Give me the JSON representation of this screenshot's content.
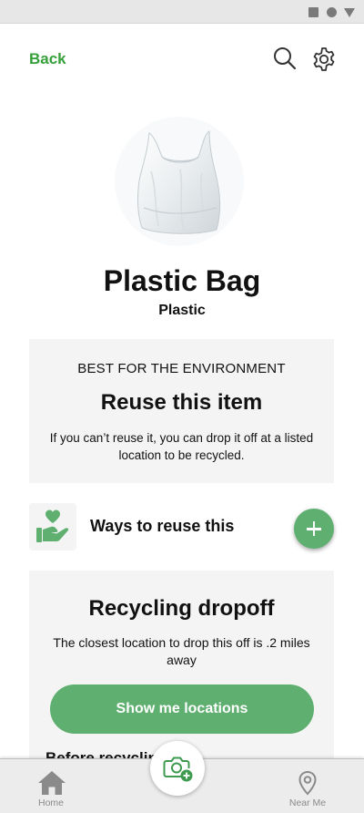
{
  "header": {
    "back_label": "Back"
  },
  "item": {
    "title": "Plastic Bag",
    "category": "Plastic"
  },
  "best_card": {
    "eyebrow": "BEST FOR THE ENVIRONMENT",
    "headline": "Reuse this item",
    "description": "If you can’t reuse it, you can drop it off at a listed location to be recycled."
  },
  "reuse_row": {
    "label": "Ways to reuse this"
  },
  "recycle_card": {
    "headline": "Recycling dropoff",
    "description": "The closest location to drop this off is .2 miles away",
    "button_label": "Show me locations",
    "next_heading": "Before recycling"
  },
  "bottom_nav": {
    "home_label": "Home",
    "near_label": "Near Me"
  },
  "colors": {
    "accent_text": "#35a03a",
    "button_green": "#5fb070",
    "card_bg": "#f4f4f4",
    "nav_icon": "#8a8a8a"
  },
  "icons": {
    "search": "search-icon",
    "settings": "gear-icon",
    "reuse": "heart-hand-icon",
    "add": "plus-icon",
    "camera": "camera-add-icon",
    "home": "home-icon",
    "near": "location-pin-icon"
  }
}
